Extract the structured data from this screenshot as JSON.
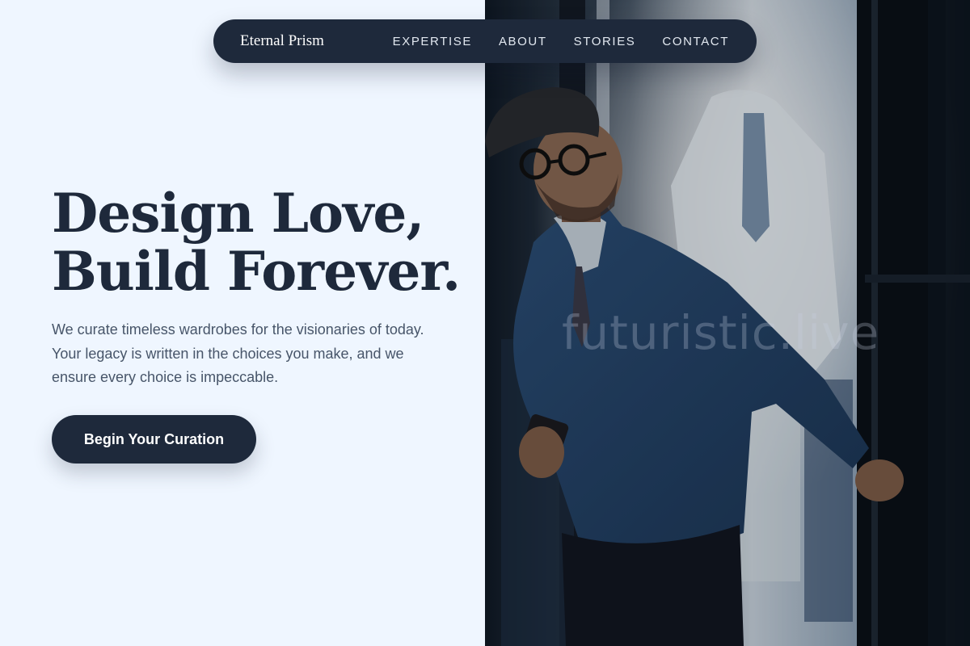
{
  "brand": {
    "name": "Eternal Prism"
  },
  "nav": {
    "links": [
      "EXPERTISE",
      "ABOUT",
      "STORIES",
      "CONTACT"
    ]
  },
  "hero": {
    "heading_line1": "Design Love,",
    "heading_line2": "Build Forever.",
    "description": "We curate timeless wardrobes for the visionaries of today. Your legacy is written in the choices you make, and we ensure every choice is impeccable.",
    "cta_label": "Begin Your Curation"
  },
  "photo": {
    "watermark_text": "futuristic.live"
  },
  "colors": {
    "background": "#eff6ff",
    "primary_dark": "#1e293b",
    "body_text": "#475569",
    "nav_text": "#e2e8f0"
  }
}
